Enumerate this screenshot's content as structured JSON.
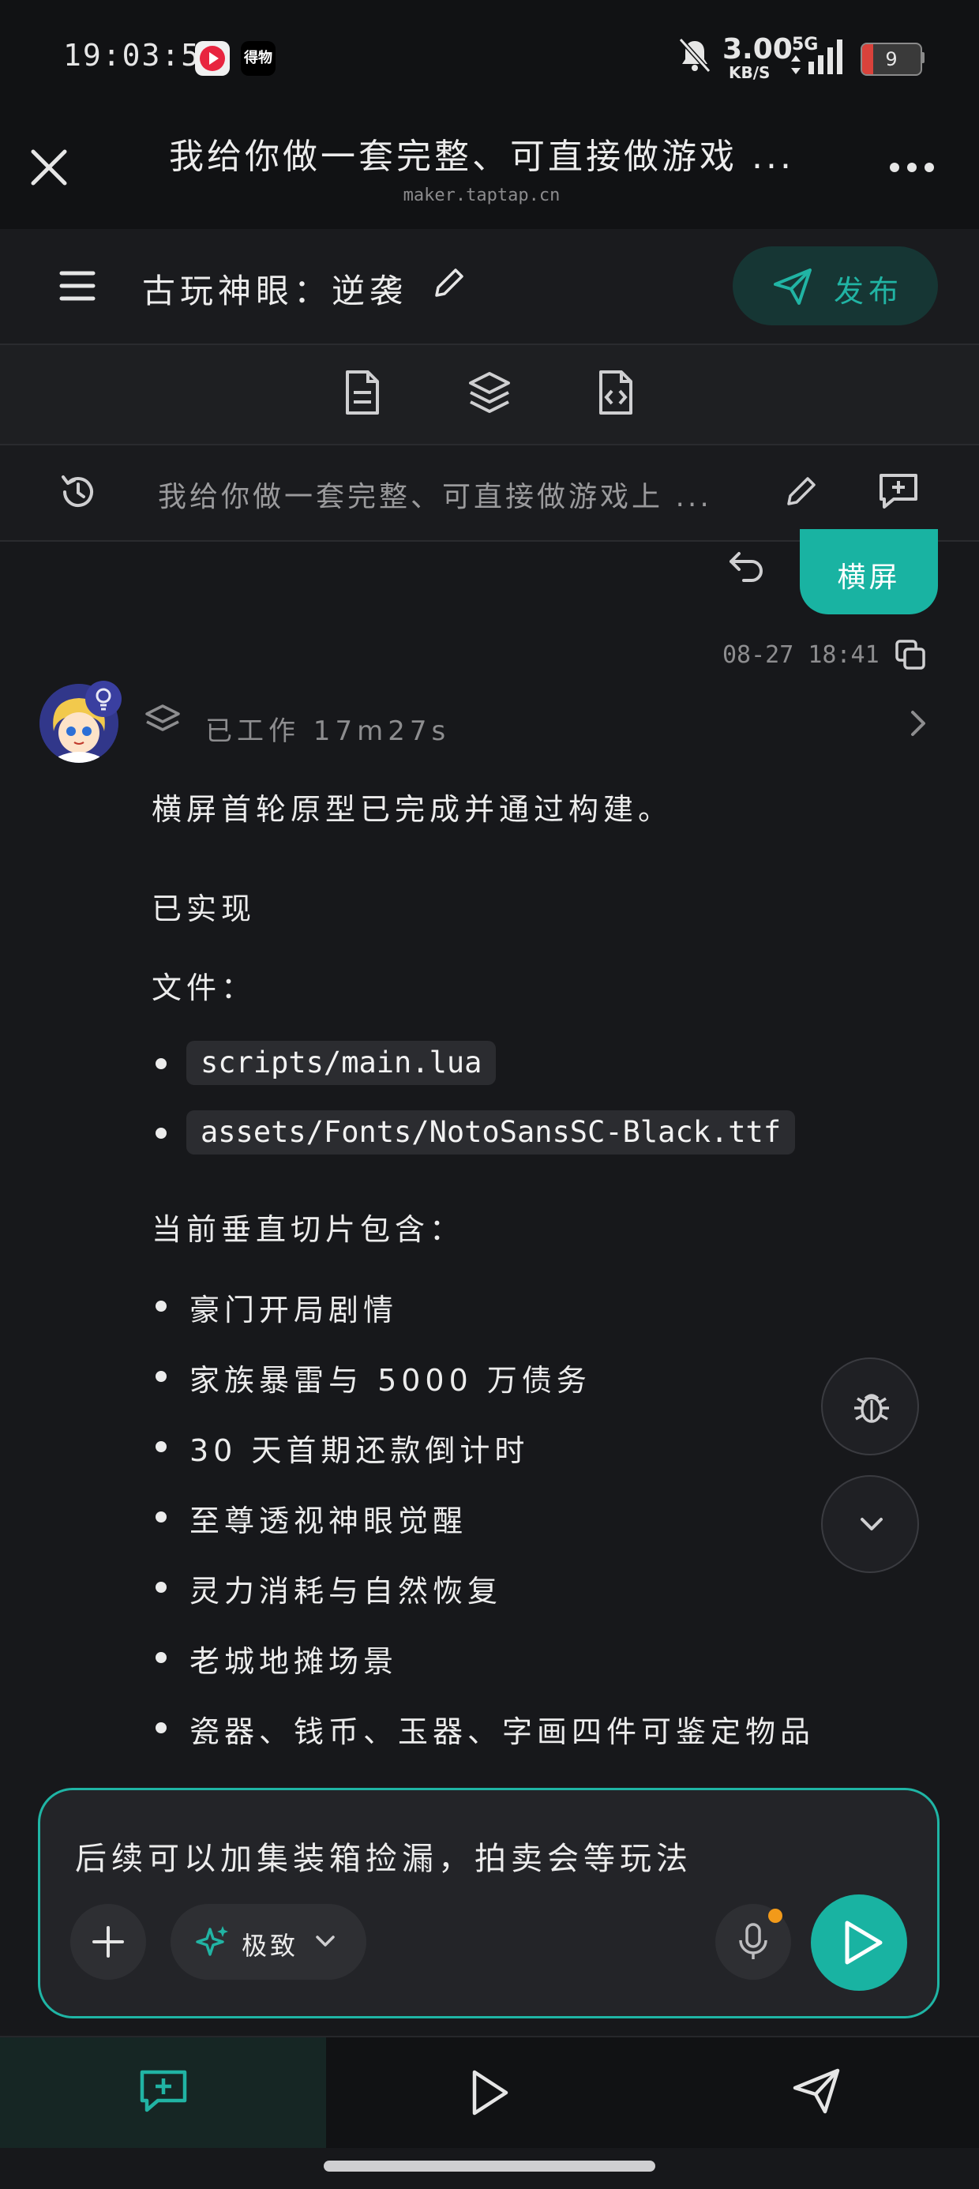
{
  "status_bar": {
    "time": "19:03:58",
    "app_badge_label": "得物",
    "net_speed": "3.00",
    "net_speed_unit": "KB/S",
    "network": "5G",
    "battery": "9",
    "battery_color": "#d9423b"
  },
  "title_bar": {
    "title": "我给你做一套完整、可直接做游戏 ...",
    "url": "maker.taptap.cn"
  },
  "project": {
    "name": "古玩神眼：逆袭",
    "publish_label": "发布"
  },
  "toolbar": {
    "icons": [
      "document-icon",
      "layers-icon",
      "code-file-icon"
    ]
  },
  "session": {
    "title": "我给你做一套完整、可直接做游戏上 ..."
  },
  "chat": {
    "user_message": "横屏",
    "message_time": "08-27 18:41",
    "work_status": "已工作 17m27s",
    "ai_intro": "横屏首轮原型已完成并通过构建。",
    "ai_done_heading": "已实现",
    "ai_files_heading": "文件：",
    "files": [
      "scripts/main.lua",
      "assets/Fonts/NotoSansSC-Black.ttf"
    ],
    "slice_heading": "当前垂直切片包含：",
    "slice_items": [
      "豪门开局剧情",
      "家族暴雷与 5000 万债务",
      "30 天首期还款倒计时",
      "至尊透视神眼觉醒",
      "灵力消耗与自然恢复",
      "老城地摊场景",
      "瓷器、钱币、玉器、字画四件可鉴定物品"
    ]
  },
  "input": {
    "text": "后续可以加集装箱捡漏，拍卖会等玩法",
    "mode_label": "极致"
  },
  "colors": {
    "accent": "#19b3a2",
    "background": "#17181b"
  }
}
